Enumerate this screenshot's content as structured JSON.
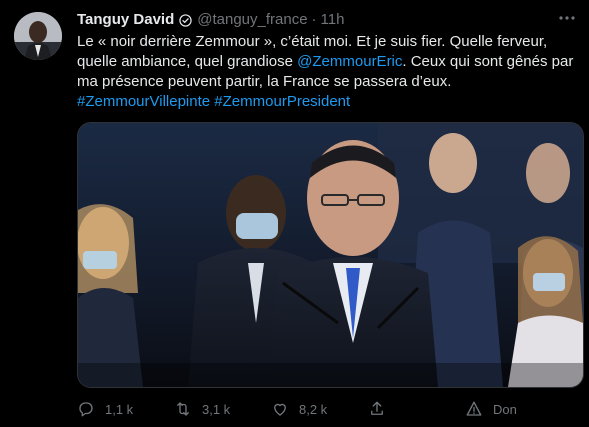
{
  "tweet": {
    "author_name": "Tanguy David",
    "author_handle": "@tanguy_france",
    "separator": "·",
    "time": "11h",
    "text_line1_a": "Le « noir derrière Zemmour », c’était moi. Et je suis fier. Quelle ferveur,",
    "text_line2_a": "quelle ambiance, quel grandiose ",
    "text_mention": "@ZemmourEric",
    "text_line2_b": ". Ceux qui sont gênés par",
    "text_line3": "ma présence peuvent partir, la France se passera d’eux.",
    "hashtag1": "#ZemmourVillepinte",
    "hashtag2": "#ZemmourPresident"
  },
  "actions": {
    "reply_count": "1,1 k",
    "retweet_count": "3,1 k",
    "like_count": "8,2 k",
    "share_label": "",
    "tip_label": "Don"
  },
  "icons": {
    "verified": "verified-badge-icon",
    "more": "more-icon",
    "reply": "reply-icon",
    "retweet": "retweet-icon",
    "like": "heart-icon",
    "share": "share-icon",
    "tip": "tip-icon"
  },
  "colors": {
    "background": "#000000",
    "text": "#e7e9ea",
    "secondary": "#71767b",
    "link": "#1d9bf0"
  }
}
